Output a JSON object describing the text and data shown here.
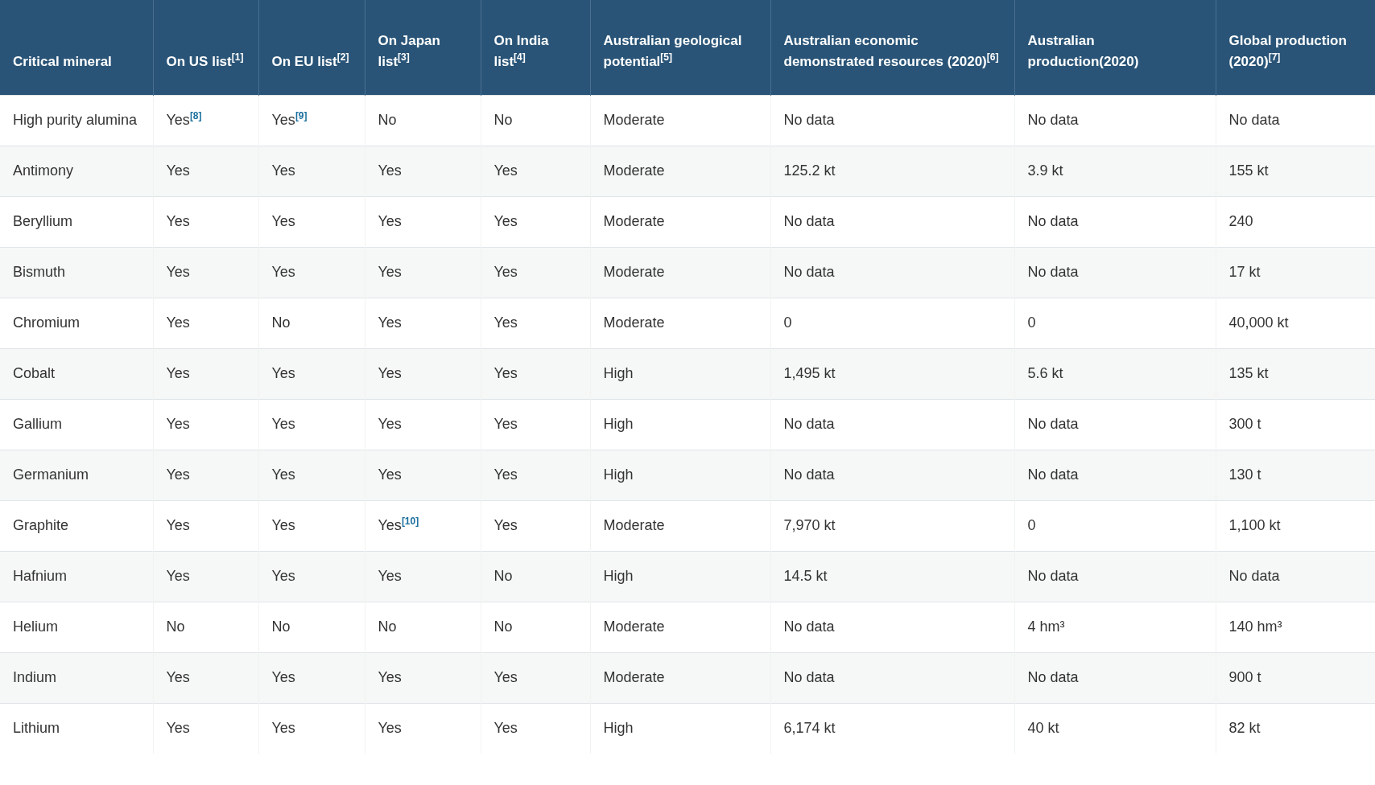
{
  "table": {
    "columns": [
      "Critical mineral",
      "On US list$^{[1]}$",
      "On EU list$^{[2]}$",
      "On Japan list$^{[3]}$",
      "On India list$^{[4]}$",
      "Australian geological potential$^{[5]}$",
      "Australian economic demonstrated resources (2020)$^{[6]}$",
      "Australian production(2020)",
      "Global production (2020)$^{[7]}$"
    ],
    "rows": [
      [
        "High purity alumina",
        "Yes$^{[8]}$",
        "Yes$^{[9]}$",
        "No",
        "No",
        "Moderate",
        "No data",
        "No data",
        "No data"
      ],
      [
        "Antimony",
        "Yes",
        "Yes",
        "Yes",
        "Yes",
        "Moderate",
        "125.2 kt",
        "3.9 kt",
        "155 kt"
      ],
      [
        "Beryllium",
        "Yes",
        "Yes",
        "Yes",
        "Yes",
        "Moderate",
        "No data",
        "No data",
        "240"
      ],
      [
        "Bismuth",
        "Yes",
        "Yes",
        "Yes",
        "Yes",
        "Moderate",
        "No data",
        "No data",
        "17 kt"
      ],
      [
        "Chromium",
        "Yes",
        "No",
        "Yes",
        "Yes",
        "Moderate",
        "0",
        "0",
        "40,000 kt"
      ],
      [
        "Cobalt",
        "Yes",
        "Yes",
        "Yes",
        "Yes",
        "High",
        "1,495 kt",
        "5.6 kt",
        "135 kt"
      ],
      [
        "Gallium",
        "Yes",
        "Yes",
        "Yes",
        "Yes",
        "High",
        "No data",
        "No data",
        "300 t"
      ],
      [
        "Germanium",
        "Yes",
        "Yes",
        "Yes",
        "Yes",
        "High",
        "No data",
        "No data",
        "130 t"
      ],
      [
        "Graphite",
        "Yes",
        "Yes",
        "Yes$^{[10]}$",
        "Yes",
        "Moderate",
        "7,970 kt",
        "0",
        "1,100 kt"
      ],
      [
        "Hafnium",
        "Yes",
        "Yes",
        "Yes",
        "No",
        "High",
        "14.5 kt",
        "No data",
        "No data"
      ],
      [
        "Helium",
        "No",
        "No",
        "No",
        "No",
        "Moderate",
        "No data",
        "4 hm³",
        "140 hm³"
      ],
      [
        "Indium",
        "Yes",
        "Yes",
        "Yes",
        "Yes",
        "Moderate",
        "No data",
        "No data",
        "900 t"
      ],
      [
        "Lithium",
        "Yes",
        "Yes",
        "Yes",
        "Yes",
        "High",
        "6,174 kt",
        "40 kt",
        "82 kt"
      ]
    ]
  }
}
